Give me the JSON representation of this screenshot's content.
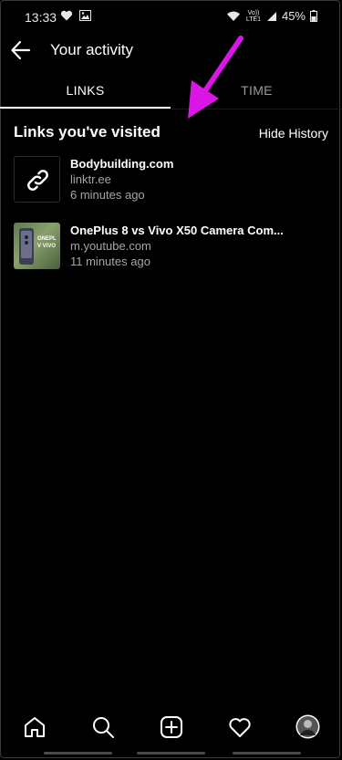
{
  "status_bar": {
    "time": "13:33",
    "battery": "45%",
    "network_label": "Vo)) LTE1",
    "icons": [
      "heart-icon",
      "image-icon",
      "wifi-icon",
      "signal-icon",
      "battery-icon"
    ]
  },
  "header": {
    "title": "Your activity",
    "back_icon": "back-arrow-icon"
  },
  "tabs": [
    {
      "label": "LINKS",
      "active": true
    },
    {
      "label": "TIME",
      "active": false
    }
  ],
  "section": {
    "title": "Links you've visited",
    "action": "Hide History"
  },
  "links": [
    {
      "title": "Bodybuilding.com",
      "domain": "linktr.ee",
      "time": "6 minutes ago",
      "thumb": "link-icon"
    },
    {
      "title": "OnePlus 8 vs Vivo X50 Camera Com...",
      "domain": "m.youtube.com",
      "time": "11 minutes ago",
      "thumb": "video-thumbnail",
      "thumb_text": "ONEPL V VIVO"
    }
  ],
  "bottom_nav": [
    "home-icon",
    "search-icon",
    "add-icon",
    "heart-icon",
    "profile-avatar"
  ],
  "colors": {
    "background": "#000000",
    "annotation": "#d916e6",
    "secondary_text": "#a6a6a6"
  }
}
